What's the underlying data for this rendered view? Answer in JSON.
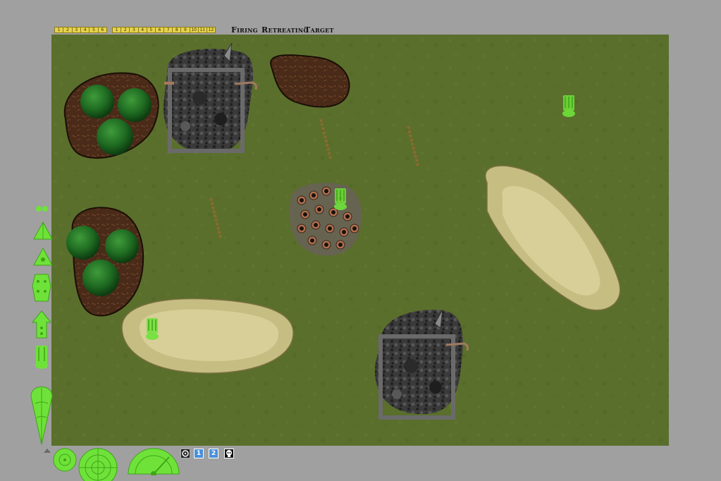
{
  "rulers": {
    "short": [
      "1",
      "2",
      "3",
      "4",
      "5",
      "6"
    ],
    "long": [
      "1",
      "2",
      "3",
      "4",
      "5",
      "6",
      "7",
      "8",
      "9",
      "10",
      "11",
      "12"
    ]
  },
  "menu": {
    "firing": "Firing",
    "retreating": "Retreating",
    "target": "Target"
  },
  "toolbar": {
    "center_icon": "crosshair-icon",
    "btn1": "1",
    "btn2": "2",
    "skull_icon": "skull-icon"
  },
  "colors": {
    "grass": "#5a6f2c",
    "unit_green": "#6fe23a",
    "sand": "#d2c88c",
    "dirt": "#4a2a18",
    "background": "#a0a0a0"
  },
  "board": {
    "terrain": [
      "ruin",
      "ruin",
      "forest",
      "forest",
      "mud-patch",
      "sand-dune",
      "sand-dune",
      "crater-field",
      "fence",
      "fence",
      "fence"
    ],
    "units": [
      "squad-unit",
      "squad-unit",
      "squad-unit"
    ]
  },
  "palette": [
    "small-template",
    "triangle-template",
    "triangle-template",
    "blast-template",
    "arrow-template",
    "unit-template",
    "flame-template"
  ],
  "templates_bottom": [
    "small-blast",
    "large-blast",
    "arc-gauge"
  ]
}
